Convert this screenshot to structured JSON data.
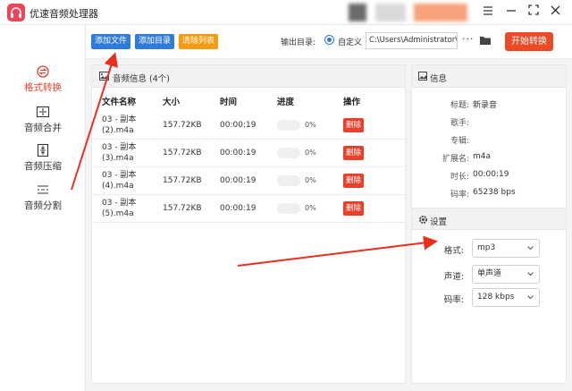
{
  "app": {
    "title": "优速音频处理器",
    "brand_color": "#f0445a",
    "accent_blue": "#2f7bd9",
    "accent_red": "#e8402b",
    "accent_orange": "#f39c12"
  },
  "window_controls": [
    "menu-icon",
    "minimize-icon",
    "fullscreen-icon",
    "close-icon"
  ],
  "sidebar": {
    "items": [
      {
        "label": "格式转换",
        "icon": "convert-icon",
        "active": true
      },
      {
        "label": "音频合并",
        "icon": "merge-icon",
        "active": false
      },
      {
        "label": "音频压缩",
        "icon": "compress-icon",
        "active": false
      },
      {
        "label": "音频分割",
        "icon": "split-icon",
        "active": false
      }
    ]
  },
  "toolbar": {
    "add_file": "添加文件",
    "add_dir": "添加目录",
    "clear_list": "清除列表",
    "output_label": "输出目录:",
    "custom_label": "自定义",
    "output_path": "C:\\Users\\Administrator\\",
    "more": "···",
    "start": "开始转换"
  },
  "file_panel": {
    "title": "音频信息 (4个)",
    "columns": [
      "文件名称",
      "大小",
      "时间",
      "进度",
      "操作"
    ],
    "rows": [
      {
        "name_line1": "03 - 副本",
        "name_line2": "(2).m4a",
        "size": "157.72KB",
        "time": "00:00:19",
        "progress": "0%",
        "progress_value": 0,
        "action": "删除"
      },
      {
        "name_line1": "03 - 副本",
        "name_line2": "(3).m4a",
        "size": "157.72KB",
        "time": "00:00:19",
        "progress": "0%",
        "progress_value": 0,
        "action": "删除"
      },
      {
        "name_line1": "03 - 副本",
        "name_line2": "(4).m4a",
        "size": "157.72KB",
        "time": "00:00:19",
        "progress": "0%",
        "progress_value": 0,
        "action": "删除"
      },
      {
        "name_line1": "03 - 副本",
        "name_line2": "(5).m4a",
        "size": "157.72KB",
        "time": "00:00:19",
        "progress": "0%",
        "progress_value": 0,
        "action": "删除"
      }
    ]
  },
  "info": {
    "title": "信息",
    "fields": [
      {
        "label": "标题:",
        "value": "新录音"
      },
      {
        "label": "歌手:",
        "value": ""
      },
      {
        "label": "专辑:",
        "value": ""
      },
      {
        "label": "扩展名:",
        "value": "m4a"
      },
      {
        "label": "时长:",
        "value": "00:00:19"
      },
      {
        "label": "码率:",
        "value": "65238 bps"
      }
    ]
  },
  "settings": {
    "title": "设置",
    "format_label": "格式:",
    "format_value": "mp3",
    "channel_label": "声道:",
    "channel_value": "单声道",
    "bitrate_label": "码率:",
    "bitrate_value": "128 kbps"
  }
}
